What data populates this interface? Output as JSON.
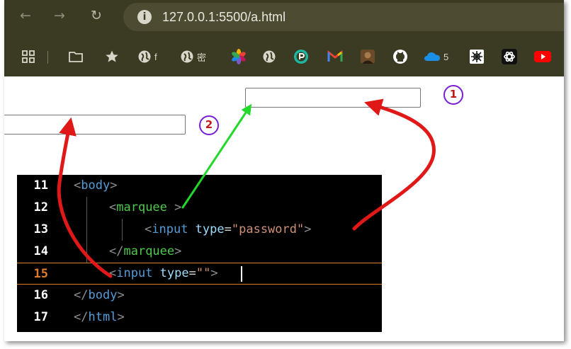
{
  "browser": {
    "nav": {
      "back_icon": "←",
      "forward_icon": "→",
      "reload_icon": "↻"
    },
    "address_bar": {
      "info_icon": "i",
      "url": "127.0.0.1:5500/a.html"
    },
    "bookmarks": [
      {
        "icon": "apps-grid-icon",
        "label": ""
      },
      {
        "icon": "folder-icon",
        "label": ""
      },
      {
        "icon": "star-icon",
        "label": ""
      },
      {
        "icon": "globe-icon",
        "label": "f"
      },
      {
        "icon": "globe-icon",
        "label": "密"
      },
      {
        "icon": "photos-pinwheel-icon",
        "label": ""
      },
      {
        "icon": "globe-icon",
        "label": ""
      },
      {
        "icon": "p-logo-icon",
        "label": ""
      },
      {
        "icon": "gmail-icon",
        "label": ""
      },
      {
        "icon": "avatar-icon",
        "label": ""
      },
      {
        "icon": "github-icon",
        "label": ""
      },
      {
        "icon": "onedrive-cloud-icon",
        "label": "5"
      },
      {
        "icon": "patterned-tile-icon",
        "label": ""
      },
      {
        "icon": "chatgpt-icon",
        "label": ""
      },
      {
        "icon": "youtube-icon",
        "label": ""
      }
    ]
  },
  "annotations": {
    "badge_1": "1",
    "badge_2": "2"
  },
  "editor": {
    "lines": [
      {
        "number": "11",
        "tokens": [
          [
            "<",
            "br"
          ],
          [
            "body",
            "tag"
          ],
          [
            ">",
            "br"
          ]
        ]
      },
      {
        "number": "12",
        "tokens": [
          [
            "<",
            "br"
          ],
          [
            "marquee",
            "mq"
          ],
          [
            " >",
            "br"
          ]
        ]
      },
      {
        "number": "13",
        "tokens": [
          [
            "<",
            "br"
          ],
          [
            "input",
            "tag"
          ],
          [
            " type",
            "attr"
          ],
          [
            "=",
            "eq"
          ],
          [
            "\"password\"",
            "str"
          ],
          [
            ">",
            "br"
          ]
        ]
      },
      {
        "number": "14",
        "tokens": [
          [
            "</",
            "br"
          ],
          [
            "marquee",
            "mq"
          ],
          [
            ">",
            "br"
          ]
        ]
      },
      {
        "number": "15",
        "tokens": [
          [
            "<",
            "br"
          ],
          [
            "input",
            "tag"
          ],
          [
            " type",
            "attr"
          ],
          [
            "=",
            "eq"
          ],
          [
            "\"\"",
            "str"
          ],
          [
            ">",
            "br"
          ]
        ]
      },
      {
        "number": "16",
        "tokens": [
          [
            "</",
            "br"
          ],
          [
            "body",
            "tag"
          ],
          [
            ">",
            "br"
          ]
        ]
      },
      {
        "number": "17",
        "tokens": [
          [
            "</",
            "br"
          ],
          [
            "html",
            "tag"
          ],
          [
            ">",
            "br"
          ]
        ]
      }
    ],
    "active_line": "15"
  },
  "colors": {
    "chrome_bg": "#3b3a23",
    "arrow_red": "#e01818",
    "arrow_green": "#22d82a",
    "badge_border": "#7a1fd6",
    "badge_text": "#c41818",
    "active_line_number": "#e07b29"
  }
}
